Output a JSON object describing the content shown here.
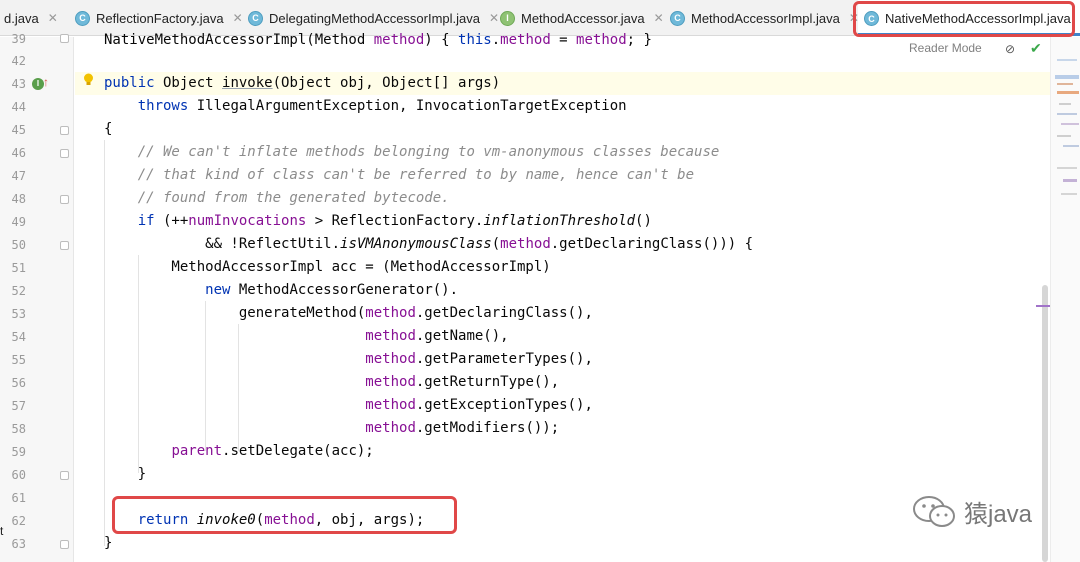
{
  "tabs": [
    {
      "label": "d.java",
      "icon": "class",
      "active": false
    },
    {
      "label": "ReflectionFactory.java",
      "icon": "class",
      "active": false
    },
    {
      "label": "DelegatingMethodAccessorImpl.java",
      "icon": "class",
      "active": false
    },
    {
      "label": "MethodAccessor.java",
      "icon": "interface",
      "active": false
    },
    {
      "label": "MethodAccessorImpl.java",
      "icon": "class",
      "active": false
    },
    {
      "label": "NativeMethodAccessorImpl.java",
      "icon": "class",
      "active": true
    }
  ],
  "tab_icon_glyphs": {
    "class": "C",
    "interface": "I"
  },
  "reader_mode_label": "Reader Mode",
  "line_numbers": [
    "39",
    "42",
    "43",
    "44",
    "45",
    "46",
    "47",
    "48",
    "49",
    "50",
    "51",
    "52",
    "53",
    "54",
    "55",
    "56",
    "57",
    "58",
    "59",
    "60",
    "61",
    "62",
    "63"
  ],
  "code_lines": [
    "NativeMethodAccessorImpl(Method method) { this.method = method; }",
    "",
    "public Object invoke(Object obj, Object[] args)",
    "    throws IllegalArgumentException, InvocationTargetException",
    "{",
    "    // We can't inflate methods belonging to vm-anonymous classes because",
    "    // that kind of class can't be referred to by name, hence can't be",
    "    // found from the generated bytecode.",
    "    if (++numInvocations > ReflectionFactory.inflationThreshold()",
    "            && !ReflectUtil.isVMAnonymousClass(method.getDeclaringClass())) {",
    "        MethodAccessorImpl acc = (MethodAccessorImpl)",
    "            new MethodAccessorGenerator().",
    "                generateMethod(method.getDeclaringClass(),",
    "                               method.getName(),",
    "                               method.getParameterTypes(),",
    "                               method.getReturnType(),",
    "                               method.getExceptionTypes(),",
    "                               method.getModifiers());",
    "        parent.setDelegate(acc);",
    "    }",
    "",
    "    return invoke0(method, obj, args);",
    "}"
  ],
  "watermark_text": "猿java",
  "stray_char": "t",
  "colors": {
    "keyword": "#0033b3",
    "field": "#871094",
    "comment": "#8c8c8c",
    "highlight_box": "#e04848",
    "active_tab_underline": "#4083c9"
  }
}
